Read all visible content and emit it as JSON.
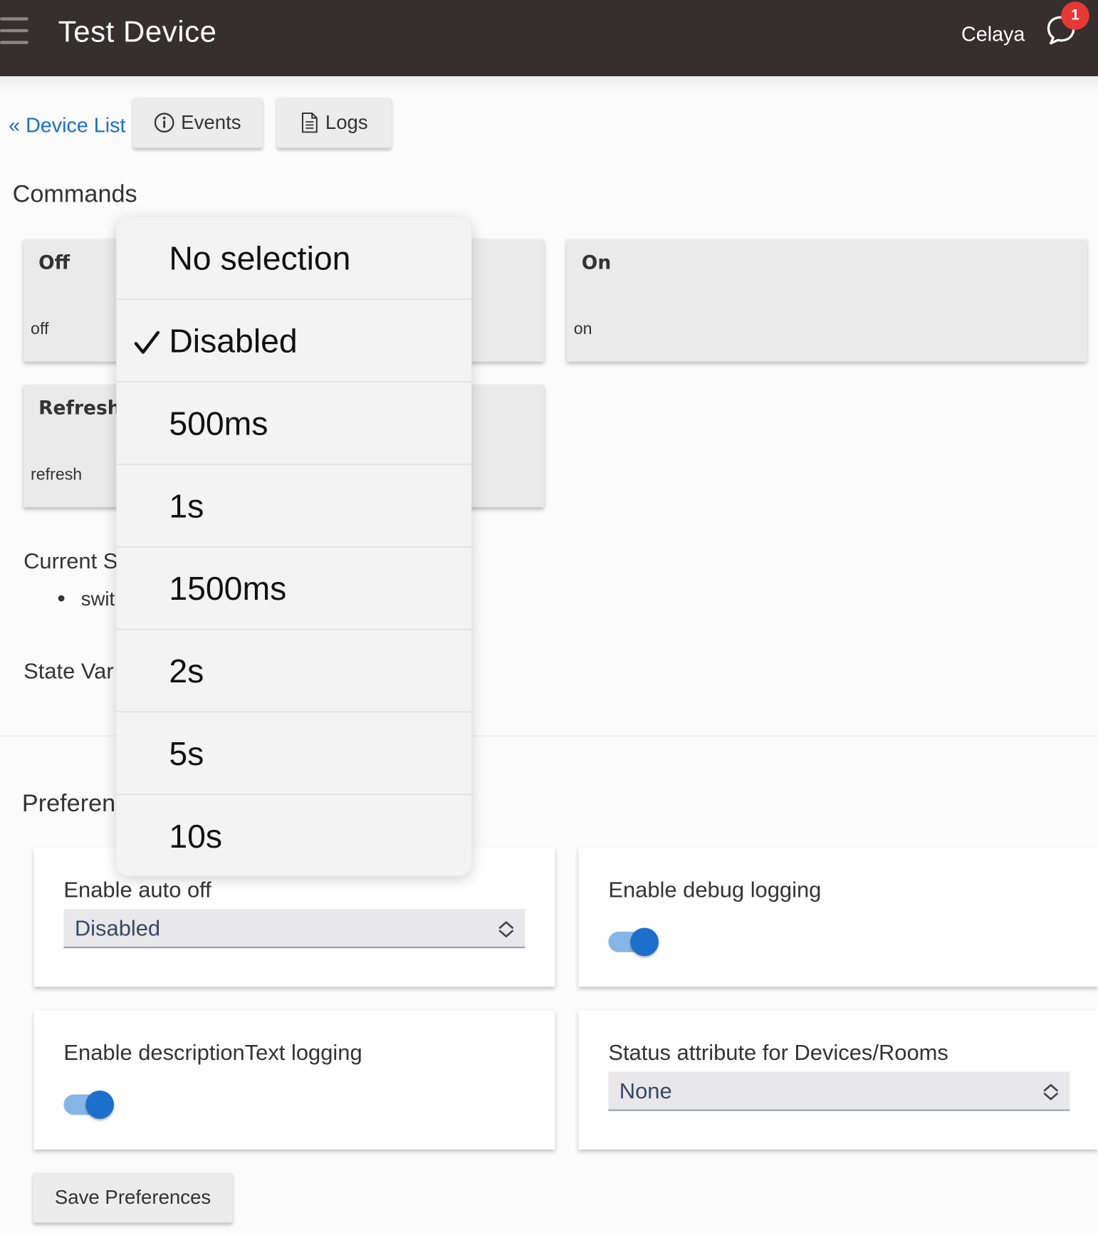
{
  "header": {
    "title": "Test Device",
    "hub_name": "Celaya",
    "notification_count": "1"
  },
  "nav": {
    "back_link": "« Device List",
    "events_label": "Events",
    "logs_label": "Logs"
  },
  "commands": {
    "title": "Commands",
    "cards": [
      {
        "name": "Off",
        "method": "off"
      },
      {
        "name": "On",
        "method": "on"
      },
      {
        "name": "Refresh",
        "method": "refresh"
      }
    ]
  },
  "current_states": {
    "title_visible": "Current S",
    "item_visible": "swit"
  },
  "state_variables": {
    "title_visible": "State Var"
  },
  "preferences": {
    "title_visible": "Preferen",
    "auto_off": {
      "label": "Enable auto off",
      "value": "Disabled"
    },
    "debug_logging": {
      "label": "Enable debug logging",
      "enabled": true
    },
    "description_logging": {
      "label": "Enable descriptionText logging",
      "enabled": true
    },
    "status_attribute": {
      "label": "Status attribute for Devices/Rooms",
      "value": "None"
    },
    "save_label": "Save Preferences"
  },
  "dropdown": {
    "selected": "Disabled",
    "options": [
      "No selection",
      "Disabled",
      "500ms",
      "1s",
      "1500ms",
      "2s",
      "5s",
      "10s"
    ]
  },
  "colors": {
    "header_bg": "#372e2e",
    "link": "#1c6fc3",
    "badge": "#e53935",
    "toggle_on": "#1d6fcc"
  }
}
